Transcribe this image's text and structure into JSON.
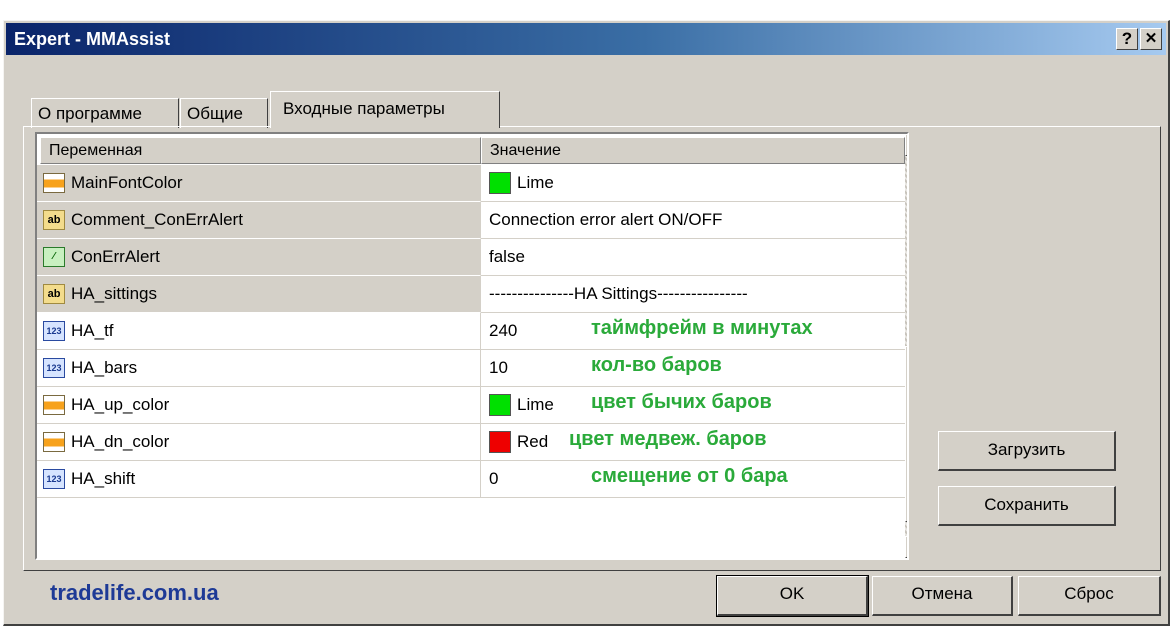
{
  "window": {
    "title": "Expert - MMAssist",
    "help_label": "?",
    "close_label": "✕"
  },
  "tabs": [
    {
      "label": "О программе",
      "active": false
    },
    {
      "label": "Общие",
      "active": false
    },
    {
      "label": "Входные параметры",
      "active": true
    }
  ],
  "grid": {
    "columns": [
      "Переменная",
      "Значение"
    ],
    "rows": [
      {
        "icon": "color-icon",
        "name": "MainFontColor",
        "value": "Lime",
        "swatch": "#00e000",
        "annotation": ""
      },
      {
        "icon": "string-icon",
        "name": "Comment_ConErrAlert",
        "value": "Connection error alert ON/OFF",
        "swatch": "",
        "annotation": ""
      },
      {
        "icon": "bool-icon",
        "name": "ConErrAlert",
        "value": "false",
        "swatch": "",
        "annotation": ""
      },
      {
        "icon": "string-icon",
        "name": "HA_sittings",
        "value": "---------------HA Sittings----------------",
        "swatch": "",
        "annotation": ""
      },
      {
        "icon": "integer-icon",
        "name": "HA_tf",
        "value": "240",
        "swatch": "",
        "annotation": "таймфрейм в минутах"
      },
      {
        "icon": "integer-icon",
        "name": "HA_bars",
        "value": "10",
        "swatch": "",
        "annotation": "кол-во баров"
      },
      {
        "icon": "color-icon",
        "name": "HA_up_color",
        "value": "Lime",
        "swatch": "#00e000",
        "annotation": "цвет бычих баров"
      },
      {
        "icon": "color-icon",
        "name": "HA_dn_color",
        "value": "Red",
        "swatch": "#ee0000",
        "annotation": "цвет медвеж. баров"
      },
      {
        "icon": "integer-icon",
        "name": "HA_shift",
        "value": "0",
        "swatch": "",
        "annotation": "смещение от  0 бара"
      }
    ],
    "scroll_position": 0.85
  },
  "side_buttons": {
    "load": "Загрузить",
    "save": "Сохранить"
  },
  "bottom_buttons": {
    "ok": "OK",
    "cancel": "Отмена",
    "reset": "Сброс"
  },
  "footer": {
    "site": "tradelife.com.ua"
  },
  "colors": {
    "annotation": "#2aaa3a",
    "footer": "#1e3a96",
    "title_bar": "#0a246a",
    "face": "#d4d0c8"
  }
}
